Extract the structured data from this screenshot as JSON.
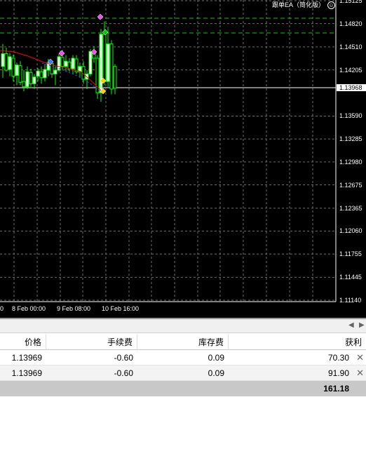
{
  "chart": {
    "ea_label": "跟单EA（简化版）",
    "price_axis": [
      "1.15125",
      "1.14820",
      "1.14510",
      "1.14205",
      "1.13968",
      "1.13590",
      "1.13285",
      "1.12980",
      "1.12675",
      "1.12365",
      "1.12060",
      "1.11755",
      "1.11445",
      "1.11140"
    ],
    "time_axis": [
      "0",
      "8 Feb 00:00",
      "9 Feb 08:00",
      "10 Feb 16:00"
    ],
    "current_price": "1.13968",
    "colors": {
      "background": "#000000",
      "grid": "#6e6e6e",
      "bull_candle": "#ffffff",
      "bear_candle": "#000000",
      "wick": "#00ff00",
      "level_line": "#00cc00",
      "ma_line": "#ff0000"
    }
  },
  "tabstrip": {
    "prev": "◀",
    "next": "▶"
  },
  "table": {
    "headers": {
      "price": "价格",
      "commission": "手续费",
      "swap": "库存费",
      "profit": "获利"
    },
    "rows": [
      {
        "price": "1.13969",
        "commission": "-0.60",
        "swap": "0.09",
        "profit": "70.30",
        "close": "✕"
      },
      {
        "price": "1.13969",
        "commission": "-0.60",
        "swap": "0.09",
        "profit": "91.90",
        "close": "✕"
      }
    ],
    "total": {
      "profit": "161.18"
    }
  }
}
